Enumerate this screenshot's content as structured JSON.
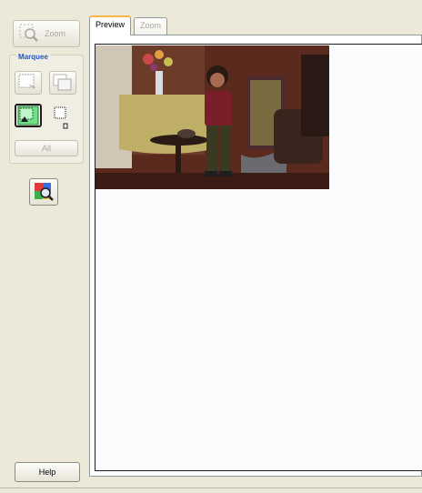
{
  "toolbar": {
    "zoom_label": "Zoom",
    "zoom_icon": "magnifier-icon",
    "marquee_group_label": "Marquee",
    "all_label": "All",
    "auto_locate_icon": "auto-locate-icon",
    "help_label": "Help"
  },
  "tabs": [
    {
      "label": "Preview",
      "active": true
    },
    {
      "label": "Zoom",
      "active": false
    }
  ],
  "preview": {
    "image_description_icon": "photo-preview",
    "marquee_selected": true
  },
  "colors": {
    "background": "#ece9d8",
    "accent_tab": "#f7b643",
    "group_label": "#1c55c8",
    "selected_marquee": "#6ee08a"
  }
}
